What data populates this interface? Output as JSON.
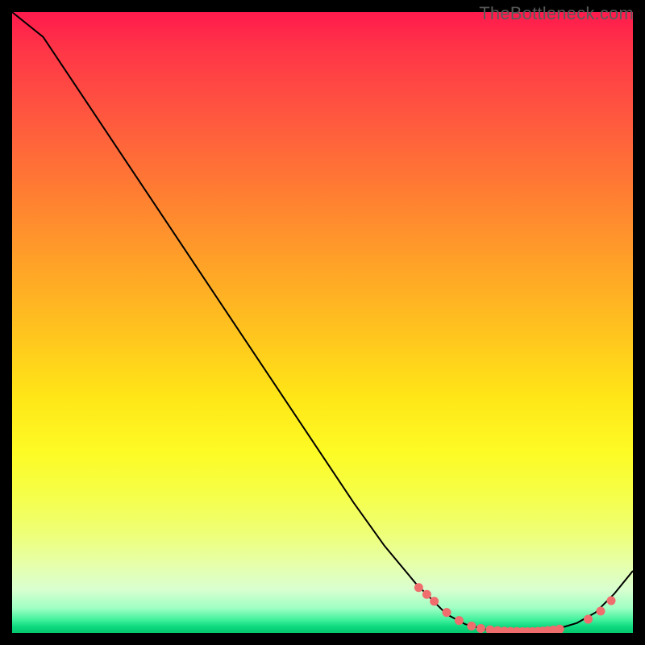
{
  "watermark": "TheBottleneck.com",
  "chart_data": {
    "type": "line",
    "title": "",
    "xlabel": "",
    "ylabel": "",
    "xlim": [
      0,
      100
    ],
    "ylim": [
      0,
      100
    ],
    "x": [
      0,
      5,
      10,
      15,
      20,
      25,
      30,
      35,
      40,
      45,
      50,
      55,
      60,
      65,
      70,
      73,
      76,
      79,
      82,
      85,
      88,
      91,
      94,
      97,
      100
    ],
    "y": [
      100,
      96,
      88.5,
      81,
      73.5,
      66,
      58.5,
      51,
      43.5,
      36,
      28.5,
      21,
      14,
      8,
      3,
      1.4,
      0.6,
      0.3,
      0.2,
      0.3,
      0.7,
      1.6,
      3.3,
      6.3,
      10
    ],
    "markers": {
      "x": [
        65.5,
        66.8,
        68,
        70,
        72,
        74,
        75.5,
        77,
        78.2,
        79.3,
        80.3,
        81.3,
        82.2,
        83,
        83.8,
        84.7,
        85.5,
        86.3,
        87.2,
        88.2,
        92.8,
        94.8,
        96.5
      ],
      "y": [
        7.3,
        6.2,
        5.1,
        3.3,
        2.0,
        1.1,
        0.72,
        0.5,
        0.38,
        0.3,
        0.25,
        0.22,
        0.2,
        0.2,
        0.21,
        0.24,
        0.3,
        0.37,
        0.47,
        0.62,
        2.2,
        3.5,
        5.2
      ],
      "style": "circle",
      "color": "#ef6d6d"
    },
    "background_gradient": {
      "from": "#ff1a4d",
      "to": "#04c86e"
    }
  }
}
